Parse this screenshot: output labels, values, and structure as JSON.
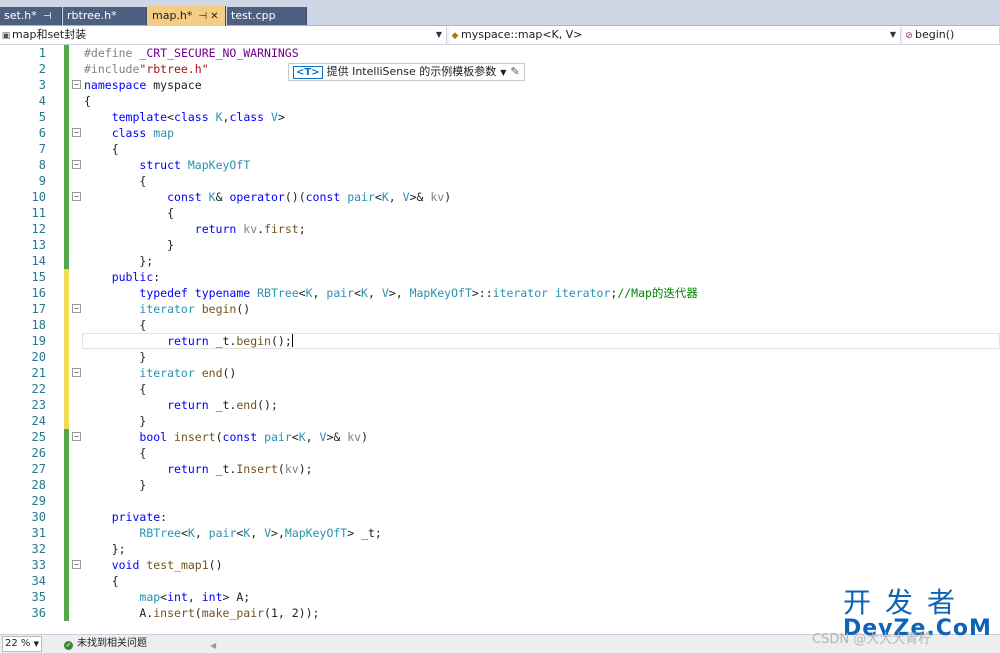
{
  "tabs": [
    {
      "label": "set.h*",
      "pin": "⊣",
      "active": false
    },
    {
      "label": "rbtree.h*",
      "active": false
    },
    {
      "label": "map.h*",
      "pin": "⊣",
      "close": "✕",
      "active": true
    },
    {
      "label": "test.cpp",
      "active": false
    }
  ],
  "navbar": {
    "project": "map和set封装",
    "scope": "myspace::map<K, V>",
    "member": "begin()"
  },
  "editor": {
    "lines": [
      {
        "n": "1",
        "change": "green"
      },
      {
        "n": "2",
        "change": "green"
      },
      {
        "n": "3",
        "change": "green"
      },
      {
        "n": "4",
        "change": "green"
      },
      {
        "n": "5",
        "change": "green"
      },
      {
        "n": "6",
        "change": "green"
      },
      {
        "n": "7",
        "change": "green"
      },
      {
        "n": "8",
        "change": "green"
      },
      {
        "n": "9",
        "change": "green"
      },
      {
        "n": "10",
        "change": "green"
      },
      {
        "n": "11",
        "change": "green"
      },
      {
        "n": "12",
        "change": "green"
      },
      {
        "n": "13",
        "change": "green"
      },
      {
        "n": "14",
        "change": "green"
      },
      {
        "n": "15",
        "change": "yellow"
      },
      {
        "n": "16",
        "change": "yellow"
      },
      {
        "n": "17",
        "change": "yellow"
      },
      {
        "n": "18",
        "change": "yellow"
      },
      {
        "n": "19",
        "change": "yellow"
      },
      {
        "n": "20",
        "change": "yellow"
      },
      {
        "n": "21",
        "change": "yellow"
      },
      {
        "n": "22",
        "change": "yellow"
      },
      {
        "n": "23",
        "change": "yellow"
      },
      {
        "n": "24",
        "change": "yellow"
      },
      {
        "n": "25",
        "change": "green"
      },
      {
        "n": "26",
        "change": "green"
      },
      {
        "n": "27",
        "change": "green"
      },
      {
        "n": "28",
        "change": "green"
      },
      {
        "n": "29",
        "change": "green"
      },
      {
        "n": "30",
        "change": "green"
      },
      {
        "n": "31",
        "change": "green"
      },
      {
        "n": "32",
        "change": "green"
      },
      {
        "n": "33",
        "change": "green"
      },
      {
        "n": "34",
        "change": "green"
      },
      {
        "n": "35",
        "change": "green"
      },
      {
        "n": "36",
        "change": "green"
      }
    ],
    "code": [
      "#define _CRT_SECURE_NO_WARNINGS",
      "#include\"rbtree.h\"",
      "namespace myspace",
      "{",
      "    template<class K,class V>",
      "    class map",
      "    {",
      "        struct MapKeyOfT",
      "        {",
      "            const K& operator()(const pair<K, V>& kv)",
      "            {",
      "                return kv.first;",
      "            }",
      "        };",
      "    public:",
      "        typedef typename RBTree<K, pair<K, V>, MapKeyOfT>::iterator iterator;//Map的迭代器",
      "        iterator begin()",
      "        {",
      "            return _t.begin();",
      "        }",
      "        iterator end()",
      "        {",
      "            return _t.end();",
      "        }",
      "        bool insert(const pair<K, V>& kv)",
      "        {",
      "            return _t.Insert(kv);",
      "        }",
      "",
      "    private:",
      "        RBTree<K, pair<K, V>,MapKeyOfT> _t;",
      "    };",
      "    void test_map1()",
      "    {",
      "        map<int, int> A;",
      "        A.insert(make_pair(1, 2));"
    ]
  },
  "hint": {
    "tag": "<T>",
    "text": "提供 IntelliSense 的示例模板参数"
  },
  "status": {
    "zoom": "22 %",
    "issues": "未找到相关问题"
  },
  "watermark": {
    "logo_cn": "开发者",
    "logo_en": "DevZe.CoM",
    "csdn": "CSDN @大大大青柠"
  },
  "colors": {
    "tab_active": "#f5cc84",
    "tab_inactive": "#4d6082",
    "change_green": "#57a64a",
    "change_yellow": "#f0dc5c",
    "line_number": "#237893",
    "keyword": "#0000ff",
    "type": "#2b91af"
  }
}
